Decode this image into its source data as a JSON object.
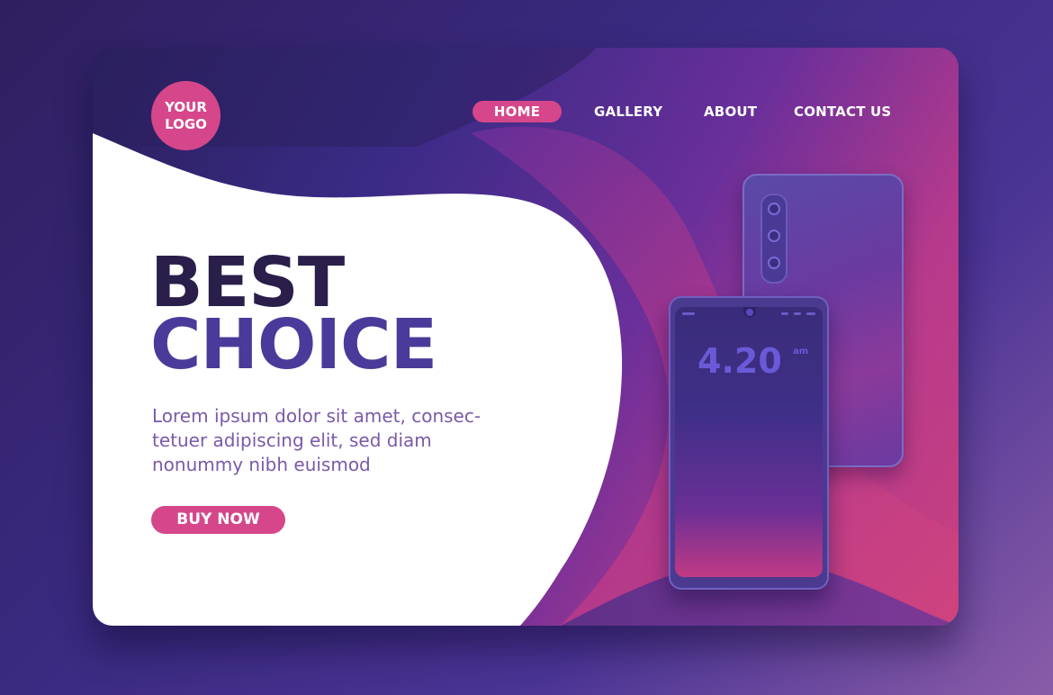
{
  "logo": {
    "line1": "YOUR",
    "line2": "LOGO"
  },
  "nav": {
    "items": [
      {
        "label": "HOME",
        "active": true
      },
      {
        "label": "GALLERY",
        "active": false
      },
      {
        "label": "ABOUT",
        "active": false
      },
      {
        "label": "CONTACT US",
        "active": false
      }
    ]
  },
  "hero": {
    "headline_line1": "BEST",
    "headline_line2": "CHOICE",
    "body_line1": "Lorem ipsum dolor sit amet, consec-",
    "body_line2": "tetuer adipiscing elit, sed diam",
    "body_line3": "nonummy nibh euismod",
    "cta_label": "BUY NOW"
  },
  "phone": {
    "clock_time": "4.20",
    "clock_suffix": "am"
  },
  "colors": {
    "accent": "#d5478a",
    "headline_dark": "#2a1e4a",
    "headline_purple": "#4a3a9a",
    "body_text": "#7a5aa8"
  },
  "icons": [
    "logo-badge",
    "camera-lens",
    "front-camera"
  ]
}
